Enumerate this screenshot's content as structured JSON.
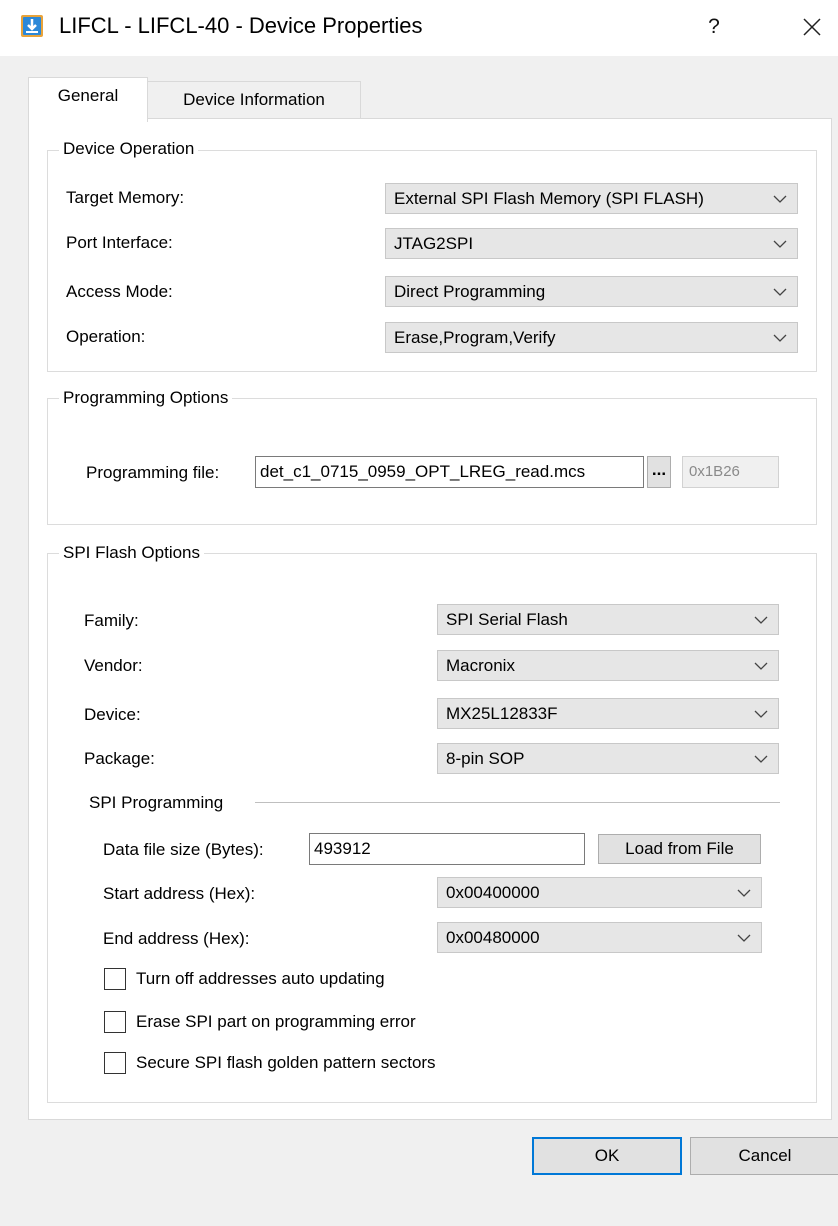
{
  "window": {
    "title": "LIFCL - LIFCL-40 - Device Properties",
    "help_label": "?",
    "close_label": "✕"
  },
  "tabs": [
    {
      "label": "General",
      "selected": true
    },
    {
      "label": "Device Information",
      "selected": false
    }
  ],
  "device_operation": {
    "legend": "Device Operation",
    "target_memory": {
      "label": "Target Memory:",
      "value": "External SPI Flash Memory (SPI FLASH)"
    },
    "port_interface": {
      "label": "Port Interface:",
      "value": "JTAG2SPI"
    },
    "access_mode": {
      "label": "Access Mode:",
      "value": "Direct Programming"
    },
    "operation": {
      "label": "Operation:",
      "value": "Erase,Program,Verify"
    }
  },
  "programming_options": {
    "legend": "Programming Options",
    "file_label": "Programming file:",
    "file_value": "det_c1_0715_0959_OPT_LREG_read.mcs",
    "browse_label": "...",
    "checksum": "0x1B26"
  },
  "spi_flash_options": {
    "legend": "SPI Flash Options",
    "family": {
      "label": "Family:",
      "value": "SPI Serial Flash"
    },
    "vendor": {
      "label": "Vendor:",
      "value": "Macronix"
    },
    "device": {
      "label": "Device:",
      "value": "MX25L12833F"
    },
    "package": {
      "label": "Package:",
      "value": "8-pin SOP"
    },
    "spi_programming": {
      "legend": "SPI Programming",
      "data_file_size": {
        "label": "Data file size (Bytes):",
        "value": "493912"
      },
      "load_button": "Load from File",
      "start_address": {
        "label": "Start address (Hex):",
        "value": "0x00400000"
      },
      "end_address": {
        "label": "End address (Hex):",
        "value": "0x00480000"
      }
    },
    "checkboxes": [
      {
        "label": "Turn off addresses auto updating",
        "checked": false
      },
      {
        "label": "Erase SPI part on programming error",
        "checked": false
      },
      {
        "label": "Secure SPI flash golden pattern sectors",
        "checked": false
      }
    ]
  },
  "footer": {
    "ok_label": "OK",
    "cancel_label": "Cancel"
  },
  "colors": {
    "accent": "#0078d7",
    "icon_blue": "#2b88d8",
    "icon_orange": "#e8a33a"
  },
  "icons": [
    "app-icon",
    "chevron-down-icon",
    "close-icon",
    "help-icon"
  ]
}
